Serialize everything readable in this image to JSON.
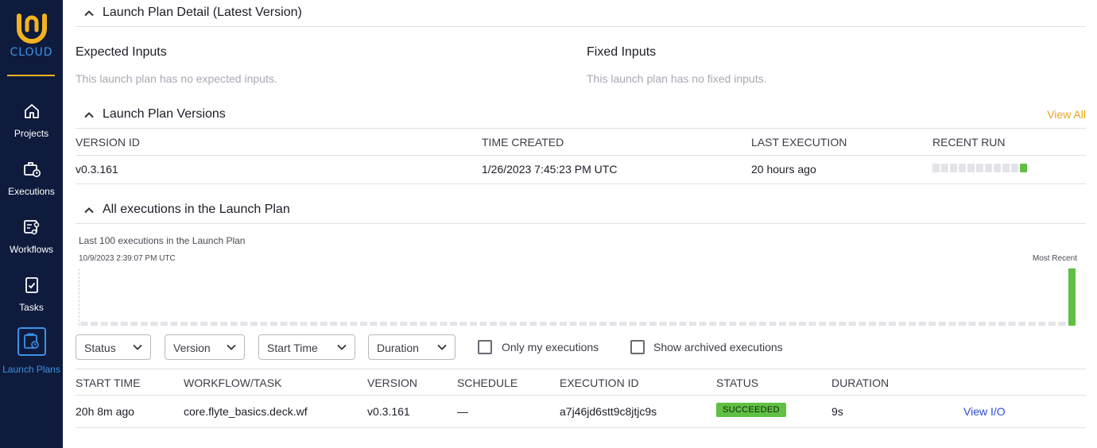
{
  "sidebar": {
    "logo_text": "CLOUD",
    "items": [
      {
        "label": "Projects",
        "icon": "home-icon"
      },
      {
        "label": "Executions",
        "icon": "briefcase-clock-icon"
      },
      {
        "label": "Workflows",
        "icon": "workflow-icon"
      },
      {
        "label": "Tasks",
        "icon": "task-check-icon"
      },
      {
        "label": "Launch Plans",
        "icon": "launch-plan-icon",
        "active": true
      }
    ],
    "colors": {
      "background": "#0f1b3d",
      "accent": "#3a93e8",
      "brand": "#f2b31e"
    }
  },
  "detail": {
    "title": "Launch Plan Detail (Latest Version)",
    "expected_inputs_title": "Expected Inputs",
    "expected_inputs_empty": "This launch plan has no expected inputs.",
    "fixed_inputs_title": "Fixed Inputs",
    "fixed_inputs_empty": "This launch plan has no fixed inputs."
  },
  "versions": {
    "title": "Launch Plan Versions",
    "view_all": "View All",
    "columns": [
      "VERSION ID",
      "TIME CREATED",
      "LAST EXECUTION",
      "RECENT RUN"
    ],
    "rows": [
      {
        "version_id": "v0.3.161",
        "time_created": "1/26/2023 7:45:23 PM UTC",
        "last_execution": "20 hours ago",
        "recent_runs": [
          "none",
          "none",
          "none",
          "none",
          "none",
          "none",
          "none",
          "none",
          "none",
          "none",
          "succeeded"
        ]
      }
    ]
  },
  "executions": {
    "title": "All executions in the Launch Plan",
    "chart_caption": "Last 100 executions in the Launch Plan",
    "chart_start": "10/9/2023 2:39:07 PM UTC",
    "chart_end": "Most Recent",
    "filters": [
      {
        "label": "Status"
      },
      {
        "label": "Version"
      },
      {
        "label": "Start Time"
      },
      {
        "label": "Duration"
      }
    ],
    "checkboxes": [
      {
        "label": "Only my executions",
        "checked": false
      },
      {
        "label": "Show archived executions",
        "checked": false
      }
    ],
    "columns": [
      "START TIME",
      "WORKFLOW/TASK",
      "VERSION",
      "SCHEDULE",
      "EXECUTION ID",
      "STATUS",
      "DURATION"
    ],
    "rows": [
      {
        "start_time": "20h 8m ago",
        "workflow": "core.flyte_basics.deck.wf",
        "version": "v0.3.161",
        "schedule": "—",
        "execution_id": "a7j46jd6stt9c8jtjc9s",
        "status": "SUCCEEDED",
        "duration": "9s",
        "action": "View I/O"
      }
    ],
    "status_color": "#5fc043"
  },
  "chart_data": {
    "type": "bar",
    "title": "Last 100 executions in the Launch Plan",
    "slots": 100,
    "filled": [
      {
        "index": 99,
        "status": "succeeded",
        "relative_duration": 1.0
      }
    ],
    "empty_color": "#e3e3e8",
    "success_color": "#5fc043"
  }
}
